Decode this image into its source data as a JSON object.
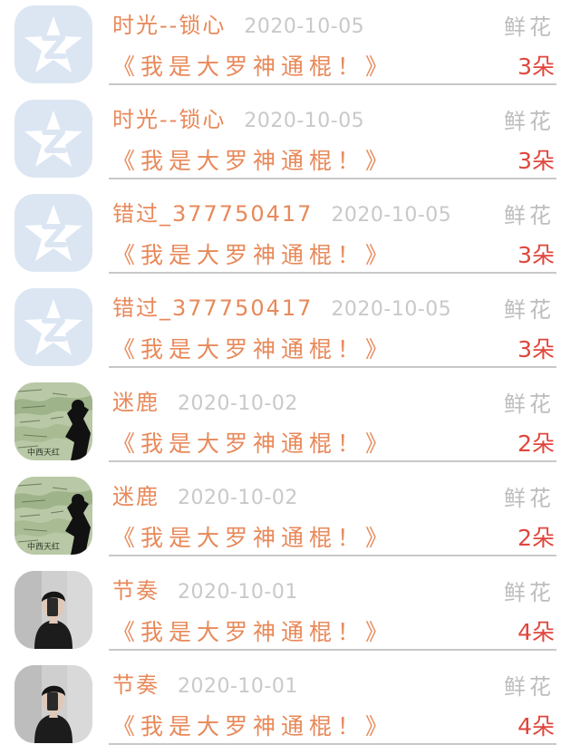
{
  "rows": [
    {
      "name": "时光--锁心",
      "date": "2020-10-05",
      "gift": "鲜花",
      "book": "《我是大罗神通棍！》",
      "count": "3朵",
      "avatar": "qzone-star-icon"
    },
    {
      "name": "时光--锁心",
      "date": "2020-10-05",
      "gift": "鲜花",
      "book": "《我是大罗神通棍！》",
      "count": "3朵",
      "avatar": "qzone-star-icon"
    },
    {
      "name": "错过_377750417",
      "date": "2020-10-05",
      "gift": "鲜花",
      "book": "《我是大罗神通棍！》",
      "count": "3朵",
      "avatar": "qzone-star-icon"
    },
    {
      "name": "错过_377750417",
      "date": "2020-10-05",
      "gift": "鲜花",
      "book": "《我是大罗神通棍！》",
      "count": "3朵",
      "avatar": "qzone-star-icon"
    },
    {
      "name": "迷鹿",
      "date": "2020-10-02",
      "gift": "鲜花",
      "book": "《我是大罗神通棍！》",
      "count": "2朵",
      "avatar": "map-silhouette-photo"
    },
    {
      "name": "迷鹿",
      "date": "2020-10-02",
      "gift": "鲜花",
      "book": "《我是大罗神通棍！》",
      "count": "2朵",
      "avatar": "map-silhouette-photo"
    },
    {
      "name": "节奏",
      "date": "2020-10-01",
      "gift": "鲜花",
      "book": "《我是大罗神通棍！》",
      "count": "4朵",
      "avatar": "mirror-selfie-photo"
    },
    {
      "name": "节奏",
      "date": "2020-10-01",
      "gift": "鲜花",
      "book": "《我是大罗神通棍！》",
      "count": "4朵",
      "avatar": "mirror-selfie-photo"
    }
  ],
  "colors": {
    "name": "#e8895a",
    "date": "#c9c9c9",
    "gift": "#bdbdbd",
    "count": "#e0463c",
    "divider": "#c8c8c8",
    "qzone_bg": "#dce6f3"
  }
}
